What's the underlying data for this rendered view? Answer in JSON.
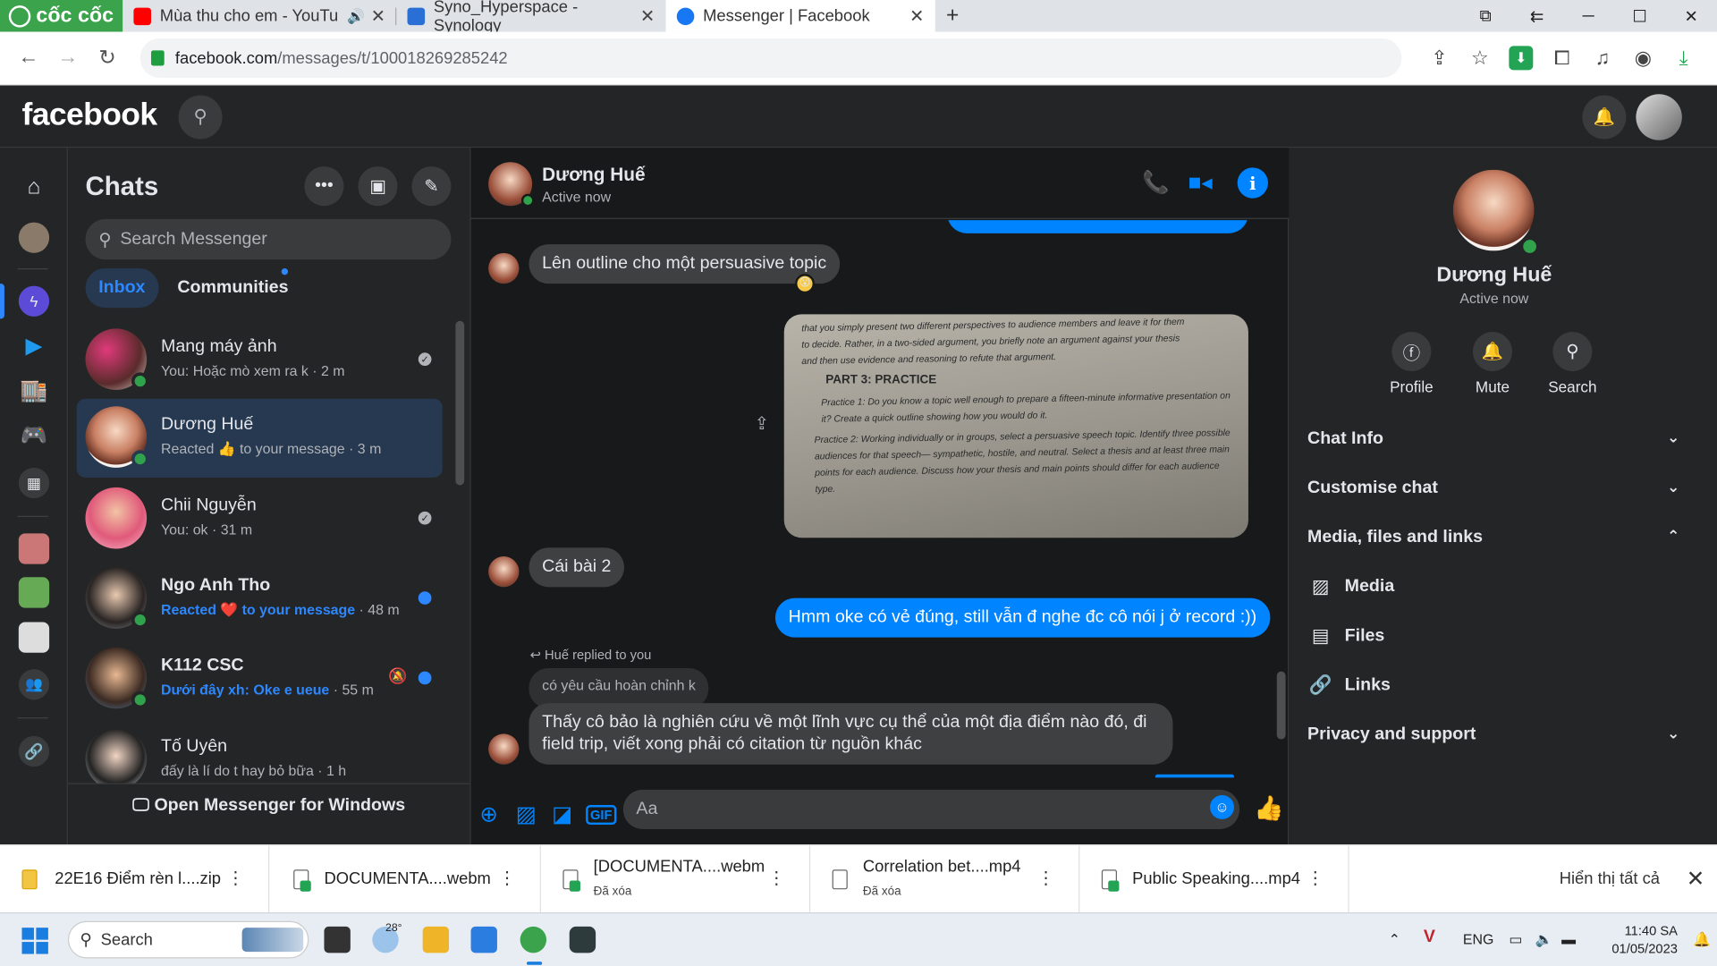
{
  "browser": {
    "brand": "cốc cốc",
    "tabs": [
      {
        "title": "Mùa thu cho em - YouTu",
        "favicon_color": "#ff0000"
      },
      {
        "title": "Syno_Hyperspace - Synology",
        "favicon_color": "#2a6fd6"
      },
      {
        "title": "Messenger | Facebook",
        "favicon_color": "#1877f2"
      }
    ],
    "url_host": "facebook.com",
    "url_path": "/messages/t/100018269285242"
  },
  "fb": {
    "logo": "facebook"
  },
  "chats": {
    "title": "Chats",
    "search_placeholder": "Search Messenger",
    "filters": [
      "Inbox",
      "Communities"
    ],
    "list": [
      {
        "name": "Mang máy ảnh",
        "preview": "You: Hoặc mò xem ra k",
        "time": "2 m",
        "unread": false,
        "online": true
      },
      {
        "name": "Dương Huế",
        "preview": "Reacted 👍 to your message",
        "time": "3 m",
        "unread": false,
        "online": true,
        "selected": true
      },
      {
        "name": "Chii Nguyễn",
        "preview": "You: ok",
        "time": "31 m",
        "unread": false,
        "online": false
      },
      {
        "name": "Ngo Anh Tho",
        "preview": "Reacted ❤️ to your message",
        "time": "48 m",
        "unread": true,
        "online": true
      },
      {
        "name": "K112 CSC",
        "preview": "Dưới đây xh: Oke e ueue",
        "time": "55 m",
        "unread": true,
        "online": true,
        "muted": true
      },
      {
        "name": "Tố Uyên",
        "preview": "đấy là lí do t hay bỏ bữa",
        "time": "1 h",
        "unread": false,
        "online": false
      }
    ],
    "open_windows": "Open Messenger for Windows"
  },
  "conversation": {
    "name": "Dương Huế",
    "status": "Active now",
    "messages": {
      "m1": "Lên outline cho một persuasive topic",
      "photo_lines": [
        "that you simply present two different perspectives to audience members and leave it for them",
        "to decide. Rather, in a two-sided argument, you briefly note an argument against your thesis",
        "and then use evidence and reasoning to refute that argument."
      ],
      "photo_heading": "PART 3: PRACTICE",
      "photo_p1": "Practice 1: Do you know a topic well enough to prepare a fifteen-minute informative presentation on it? Create a quick outline showing how you would do it.",
      "photo_p2": "Practice 2: Working individually or in groups, select a persuasive speech topic. Identify three possible audiences for that speech— sympathetic, hostile, and neutral. Select a thesis and at least three main points for each audience. Discuss how your thesis and main points should differ for each audience type.",
      "m2": "Cái bài 2",
      "m3": "Hmm oke có vẻ đúng, still vẫn đ nghe đc cô nói j ở record :))",
      "reply_label": "Huế replied to you",
      "quoted": "có yêu cầu hoàn chỉnh k",
      "m4": "Thấy cô bảo là nghiên cứu về một lĩnh vực cụ thể của một địa điểm nào đó, đi field trip, viết xong phải có citation từ nguồn khác"
    },
    "composer_placeholder": "Aa"
  },
  "info": {
    "name": "Dương Huế",
    "status": "Active now",
    "actions": [
      "Profile",
      "Mute",
      "Search"
    ],
    "sections": [
      "Chat Info",
      "Customise chat",
      "Media, files and links"
    ],
    "sub": [
      "Media",
      "Files",
      "Links"
    ],
    "privacy": "Privacy and support"
  },
  "downloads": [
    {
      "name": "22E16 Điểm rèn l....zip",
      "status": ""
    },
    {
      "name": "DOCUMENTA....webm",
      "status": ""
    },
    {
      "name": "[DOCUMENTA....webm",
      "status": "Đã xóa"
    },
    {
      "name": "Correlation bet....mp4",
      "status": "Đã xóa"
    },
    {
      "name": "Public Speaking....mp4",
      "status": ""
    }
  ],
  "downloads_show_all": "Hiển thị tất cả",
  "taskbar": {
    "search": "Search",
    "weather": "28°",
    "lang": "ENG",
    "time": "11:40 SA",
    "date": "01/05/2023"
  }
}
